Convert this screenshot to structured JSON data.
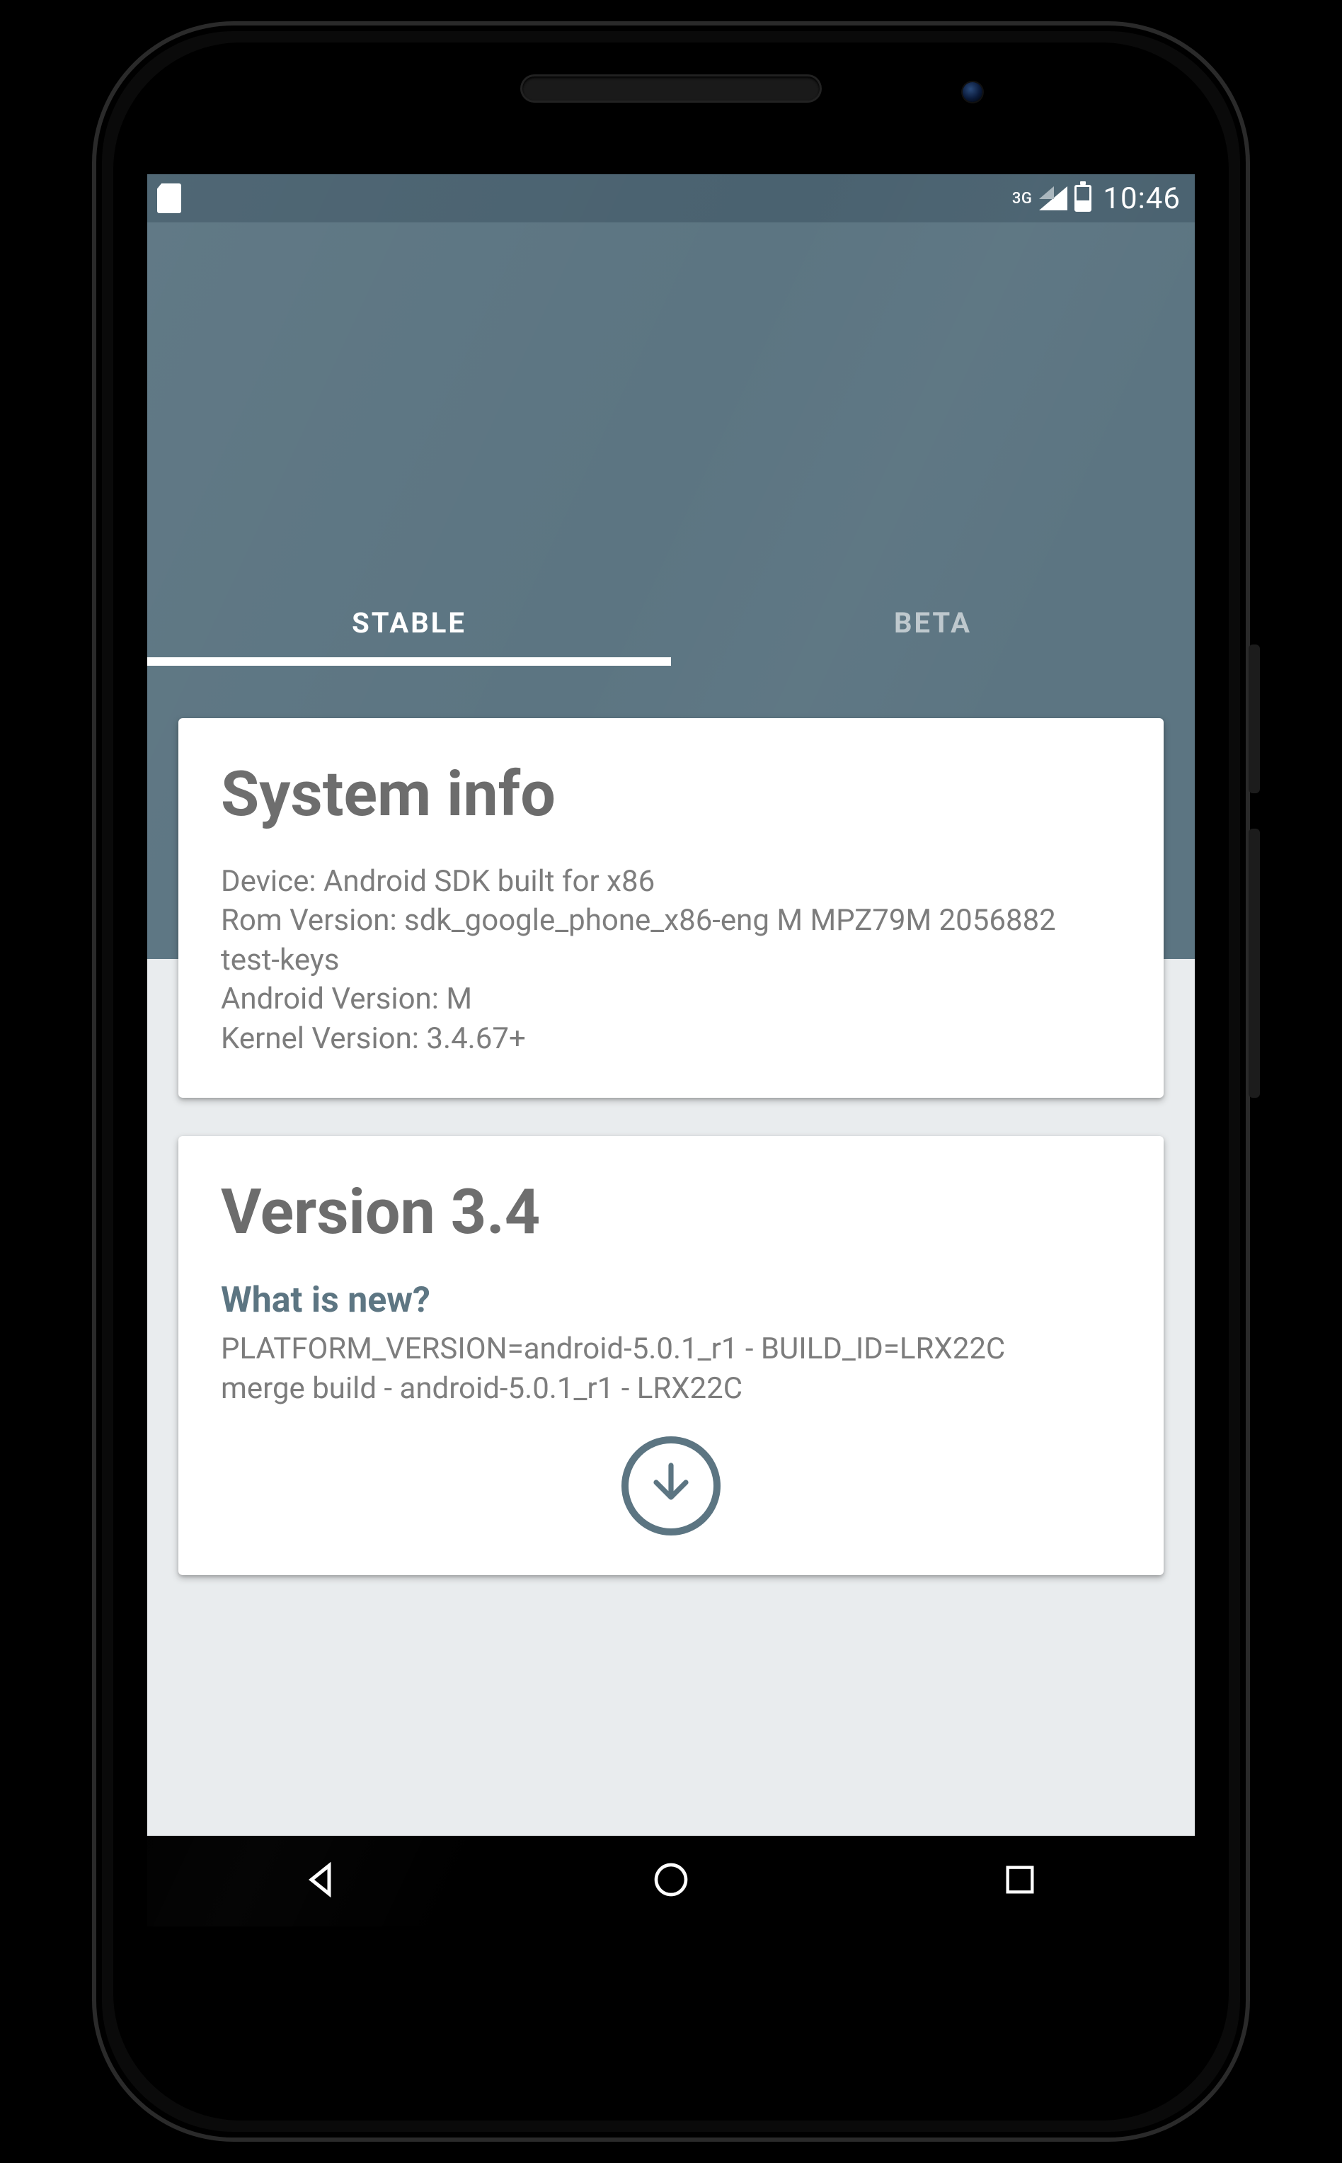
{
  "statusbar": {
    "network_label": "3G",
    "clock": "10:46"
  },
  "tabs": [
    {
      "label": "STABLE",
      "active": true
    },
    {
      "label": "BETA",
      "active": false
    }
  ],
  "cards": {
    "system_info": {
      "title": "System info",
      "body": "Device: Android SDK built for x86\nRom Version: sdk_google_phone_x86-eng M MPZ79M 2056882 test-keys\nAndroid Version: M\nKernel Version: 3.4.67+"
    },
    "version": {
      "title": "Version 3.4",
      "subtitle": "What is new?",
      "body": "PLATFORM_VERSION=android-5.0.1_r1 - BUILD_ID=LRX22C\nmerge build - android-5.0.1_r1 - LRX22C"
    }
  },
  "colors": {
    "primary": "#5c7582",
    "primary_dark": "#4a6270",
    "body_bg": "#e9ecee",
    "text_heading": "#6c6c6c",
    "text_body": "#7c7c7c"
  }
}
